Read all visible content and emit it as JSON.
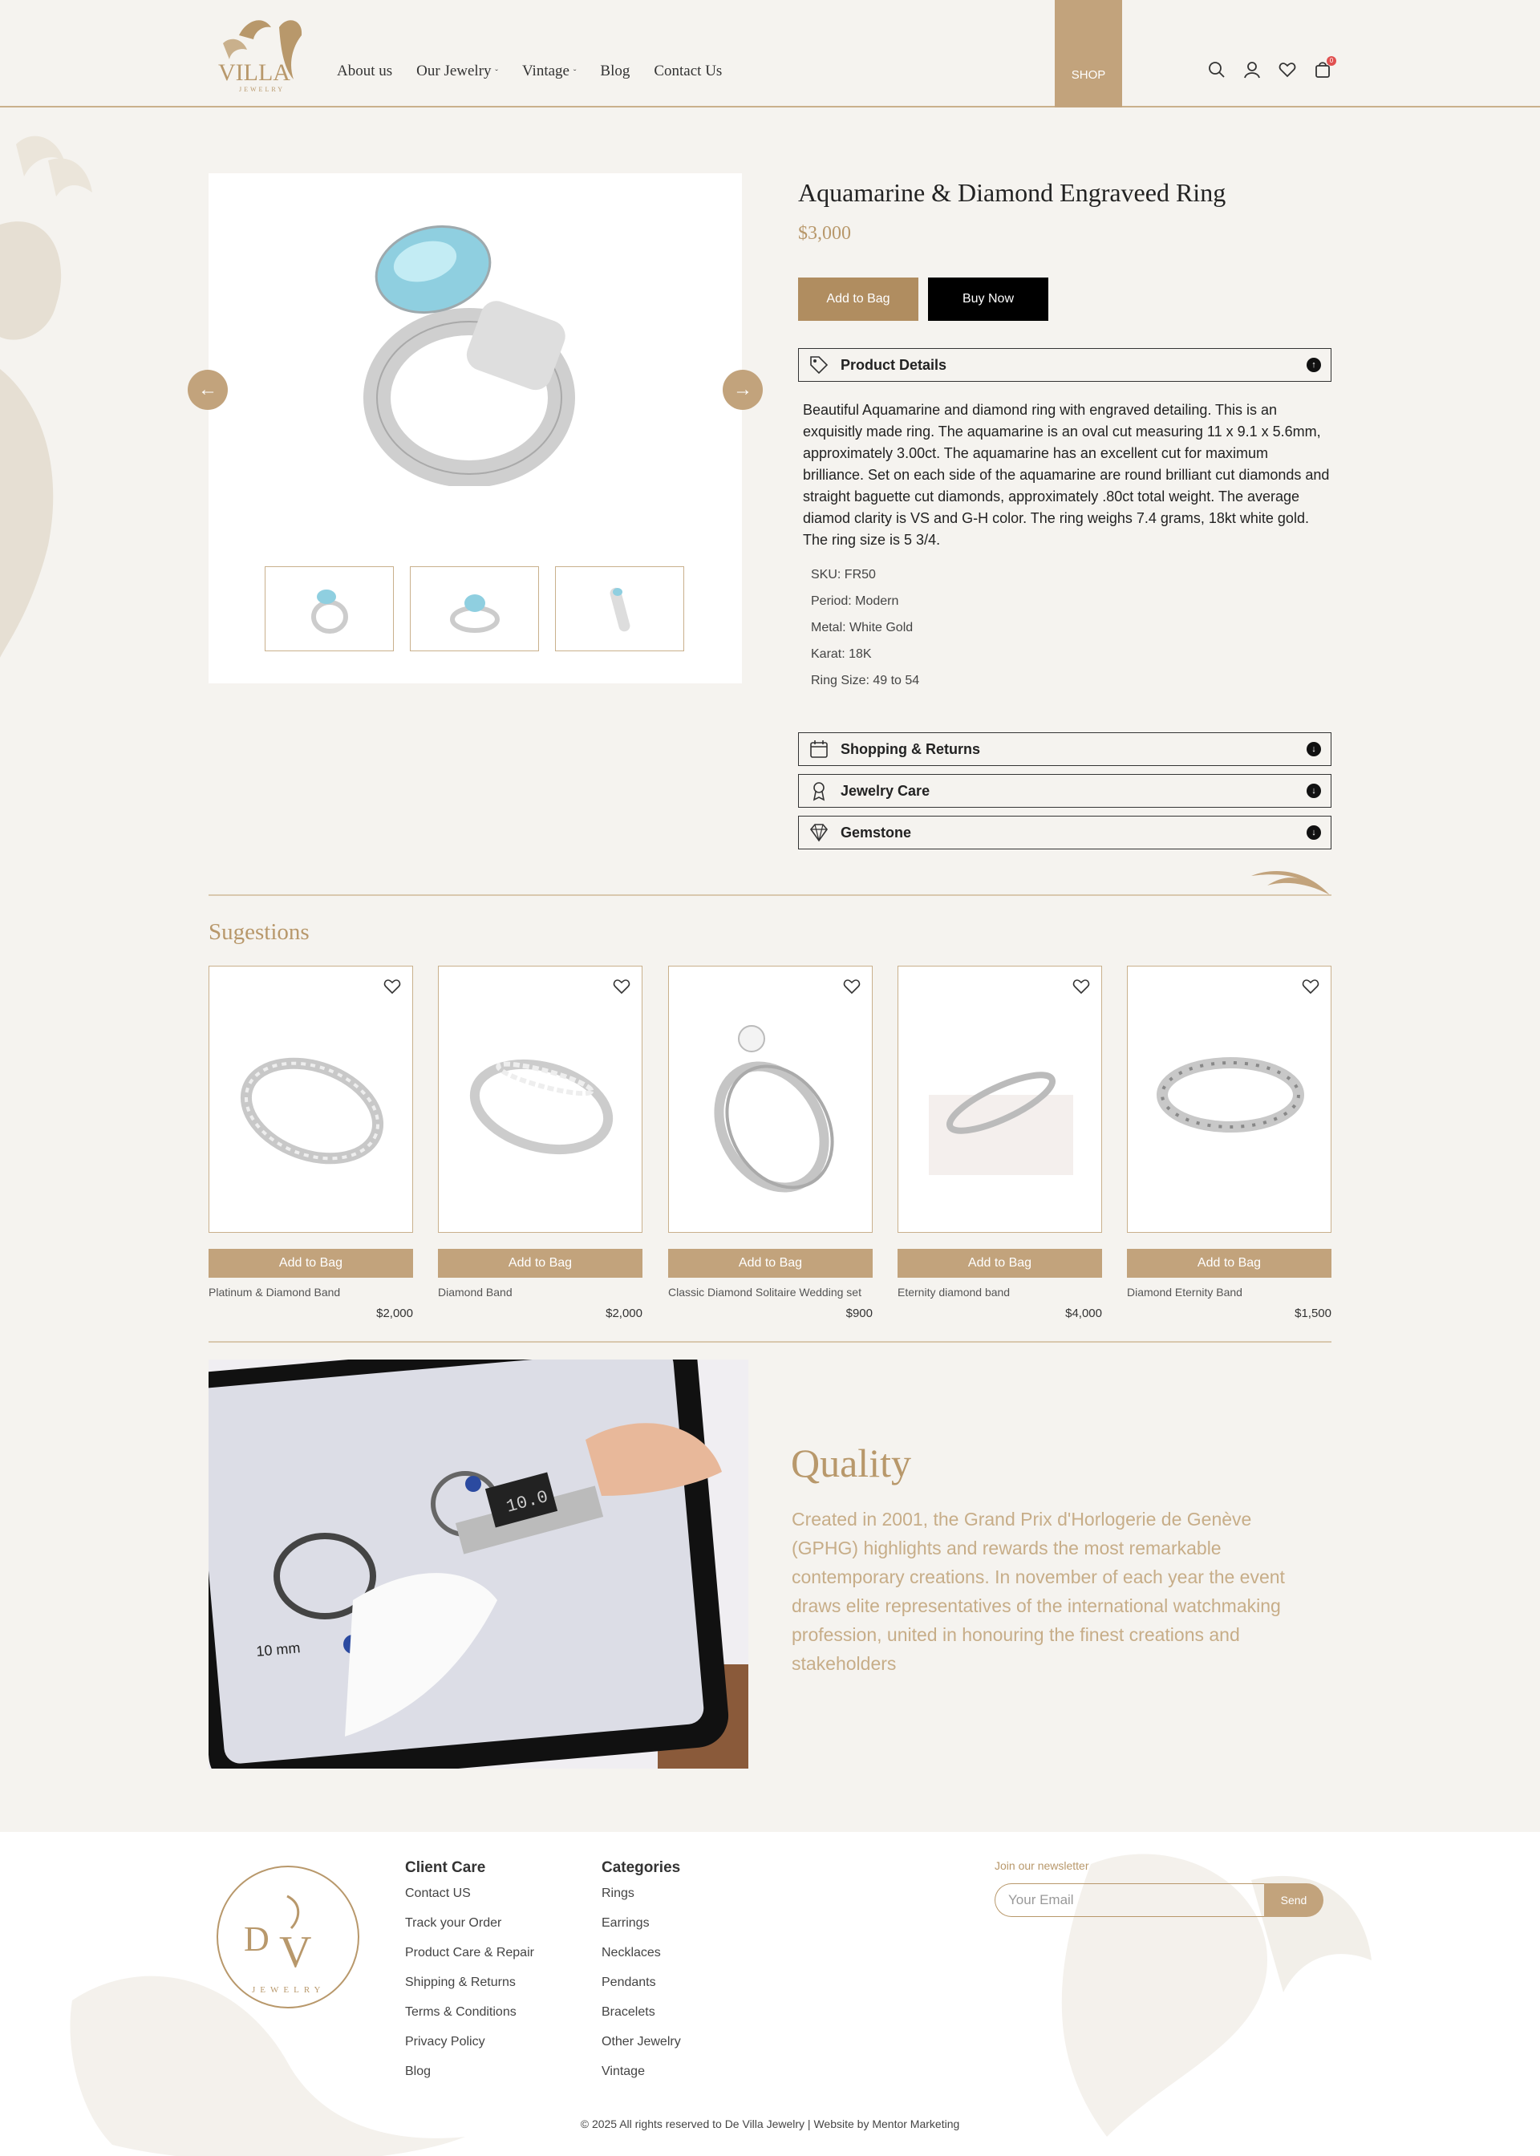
{
  "brand": {
    "logo_text": "De VILLA JEWELRY"
  },
  "nav": {
    "about": "About us",
    "jewelry": "Our Jewelry",
    "vintage": "Vintage",
    "blog": "Blog",
    "contact": "Contact Us",
    "shop": "SHOP",
    "cart_count": "0"
  },
  "product": {
    "title": "Aquamarine & Diamond Engraveed Ring",
    "price": "$3,000",
    "add_to_bag": "Add to Bag",
    "buy_now": "Buy Now",
    "details_label": "Product Details",
    "description": "Beautiful Aquamarine and diamond ring with engraved detailing. This is an exquisitly made ring. The aquamarine is an oval cut measuring 11 x 9.1 x 5.6mm, approximately 3.00ct. The aquamarine has an excellent cut for maximum brilliance. Set on each side of the aquamarine are round brilliant cut diamonds and straight baguette cut diamonds, approximately .80ct total weight. The average diamod clarity is VS and G-H color. The ring weighs 7.4 grams, 18kt white gold. The ring size is 5 3/4.",
    "specs": {
      "sku": "SKU: FR50",
      "period": "Period: Modern",
      "metal": "Metal: White Gold",
      "karat": "Karat: 18K",
      "size": "Ring Size: 49 to 54"
    },
    "shipping_label": "Shopping & Returns",
    "care_label": "Jewelry Care",
    "gemstone_label": "Gemstone"
  },
  "suggestions": {
    "title": "Sugestions",
    "add_label": "Add to Bag",
    "items": [
      {
        "name": "Platinum & Diamond Band",
        "price": "$2,000"
      },
      {
        "name": "Diamond Band",
        "price": "$2,000"
      },
      {
        "name": "Classic Diamond Solitaire Wedding set",
        "price": "$900"
      },
      {
        "name": "Eternity diamond band",
        "price": "$4,000"
      },
      {
        "name": "Diamond Eternity Band",
        "price": "$1,500"
      }
    ]
  },
  "quality": {
    "title": "Quality",
    "text": "Created in 2001, the Grand Prix d'Horlogerie de Genève (GPHG) highlights and rewards the most remarkable contemporary creations. In november of each year the event draws elite representatives of the international watchmaking profession, united in honouring the finest creations and stakeholders",
    "caliper_reading": "10.0",
    "mm_label": "10 mm"
  },
  "footer": {
    "client_care": {
      "title": "Client Care",
      "links": [
        "Contact US",
        "Track your Order",
        "Product Care & Repair",
        "Shipping & Returns",
        "Terms & Conditions",
        "Privacy Policy",
        "Blog"
      ]
    },
    "categories": {
      "title": "Categories",
      "links": [
        "Rings",
        "Earrings",
        "Necklaces",
        "Pendants",
        "Bracelets",
        "Other Jewelry",
        "Vintage"
      ]
    },
    "newsletter_label": "Join our newsletter",
    "email_placeholder": "Your Email",
    "send": "Send",
    "copyright": "© 2025 All rights reserved to De Villa Jewelry | Website by Mentor Marketing"
  },
  "colors": {
    "gold": "#b8986b",
    "accent": "#c2a37c",
    "background": "#f5f3ef"
  }
}
